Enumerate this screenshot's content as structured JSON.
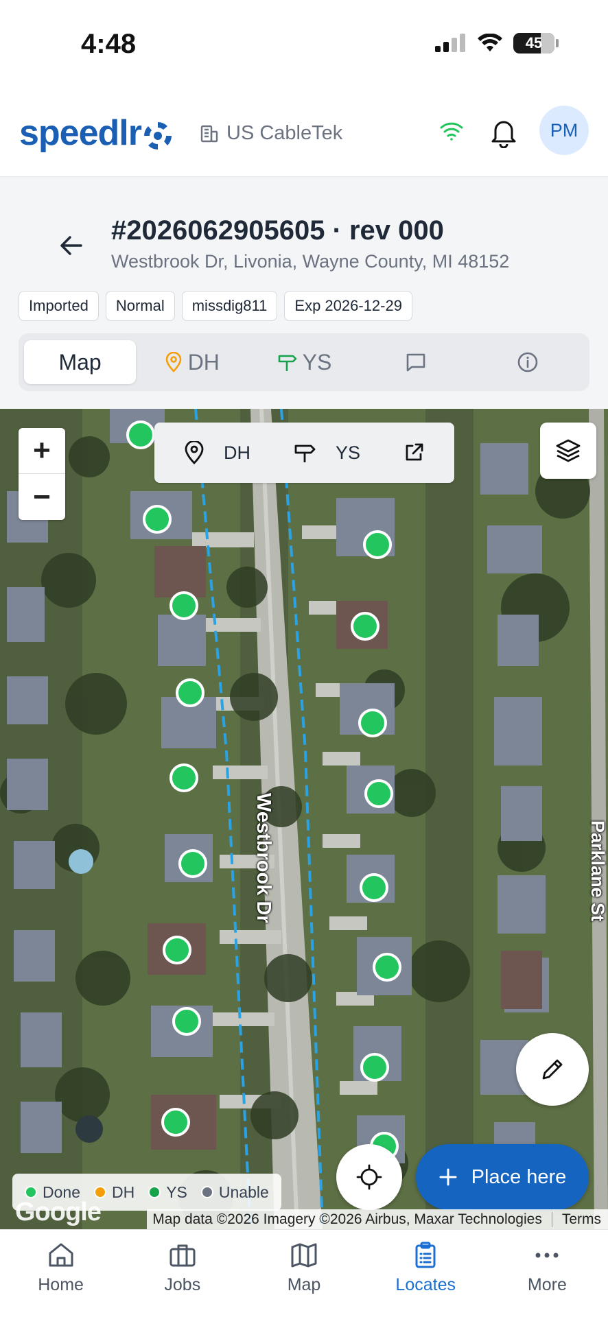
{
  "status_bar": {
    "time": "4:48",
    "battery": "45"
  },
  "header": {
    "logo_text": "speedlr",
    "org_name": "US CableTek",
    "avatar_initials": "PM"
  },
  "job": {
    "title": "#2026062905605 · rev 000",
    "address": "Westbrook Dr, Livonia, Wayne County, MI 48152",
    "tags": [
      "Imported",
      "Normal",
      "missdig811",
      "Exp 2026-12-29"
    ]
  },
  "tabs": {
    "map": "Map",
    "dh": "DH",
    "ys": "YS"
  },
  "map": {
    "zoom_in": "+",
    "zoom_out": "−",
    "toolbar": {
      "dh": "DH",
      "ys": "YS"
    },
    "street_label": "Westbrook Dr",
    "street_label_right": "Parklane St",
    "place_button": "Place here",
    "legend": [
      {
        "label": "Done",
        "color": "#22c55e"
      },
      {
        "label": "DH",
        "color": "#f59e0b"
      },
      {
        "label": "YS",
        "color": "#16a34a"
      },
      {
        "label": "Unable",
        "color": "#6b7280"
      }
    ],
    "attribution": "Map data ©2026 Imagery ©2026 Airbus, Maxar Technologies",
    "terms": "Terms",
    "google": "Google"
  },
  "bottom_nav": {
    "home": "Home",
    "jobs": "Jobs",
    "map": "Map",
    "locates": "Locates",
    "more": "More"
  },
  "colors": {
    "brand": "#1a5fb4",
    "accent": "#1565c0",
    "done": "#22c55e",
    "ys": "#16a34a",
    "dh": "#f59e0b"
  }
}
